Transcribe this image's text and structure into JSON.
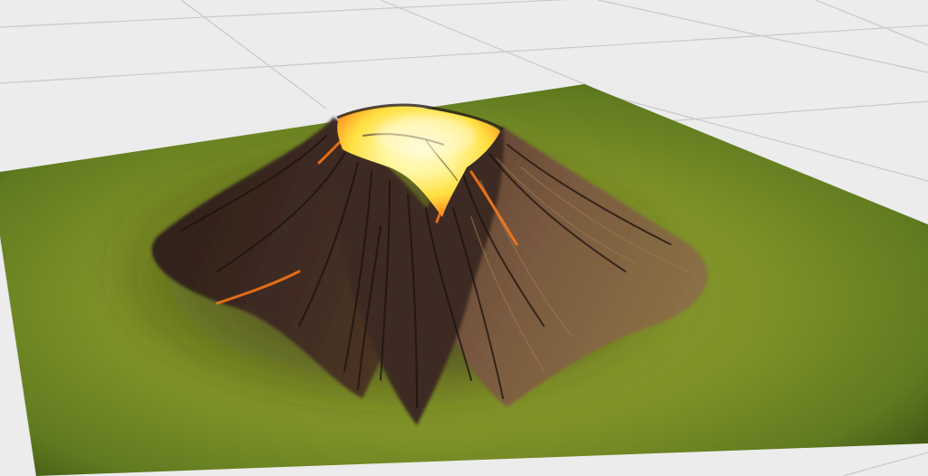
{
  "scene": {
    "background_color": "#ececec",
    "grid_line_color": "#c9c9c9",
    "terrain_colors": {
      "grass_light": "#8a9a2c",
      "grass_mid": "#6f8226",
      "grass_dark": "#3f5716",
      "rock_dark": "#2a1d18",
      "rock_mid": "#5a4030",
      "rock_light": "#8a6a4a",
      "lava_glow": "#ff8a1e",
      "lava_core": "#fff6a0",
      "lava_hot": "#ffe040"
    },
    "icons": {
      "terrain": "volcano-terrain-icon"
    }
  }
}
